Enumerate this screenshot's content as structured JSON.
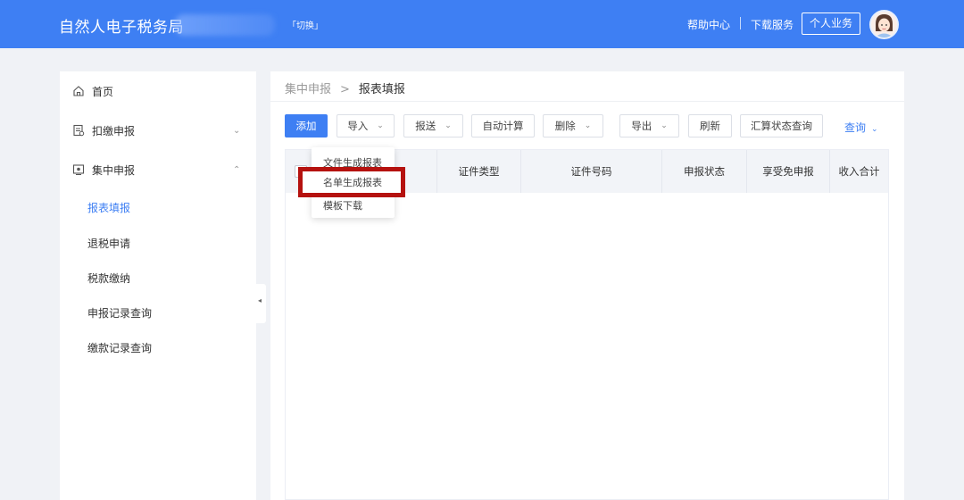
{
  "header": {
    "app_title": "自然人电子税务局",
    "switch_label": "「切换」",
    "help_label": "帮助中心",
    "download_label": "下载服务",
    "personal_label": "个人业务"
  },
  "sidebar": {
    "items": [
      {
        "label": "首页",
        "icon": "home-icon"
      },
      {
        "label": "扣缴申报",
        "icon": "document-icon",
        "chevron": "⌄"
      },
      {
        "label": "集中申报",
        "icon": "screen-icon",
        "chevron": "⌃"
      }
    ],
    "subitems": [
      {
        "label": "报表填报",
        "active": true
      },
      {
        "label": "退税申请"
      },
      {
        "label": "税款缴纳"
      },
      {
        "label": "申报记录查询"
      },
      {
        "label": "缴款记录查询"
      }
    ],
    "collapse_glyph": "◂"
  },
  "breadcrumb": {
    "parent": "集中申报",
    "separator": ">",
    "current": "报表填报"
  },
  "toolbar": {
    "add": "添加",
    "import": "导入",
    "submit": "报送",
    "auto_calc": "自动计算",
    "delete": "删除",
    "export": "导出",
    "refresh": "刷新",
    "summary_status": "汇算状态查询",
    "query": "查询",
    "chevron": "⌄"
  },
  "table": {
    "columns": [
      "证件类型",
      "证件号码",
      "申报状态",
      "享受免申报",
      "收入合计"
    ]
  },
  "import_menu": {
    "items": [
      "文件生成报表",
      "名单生成报表",
      "模板下载"
    ]
  },
  "colors": {
    "accent": "#3e7ff3",
    "highlight": "#b5120f"
  }
}
